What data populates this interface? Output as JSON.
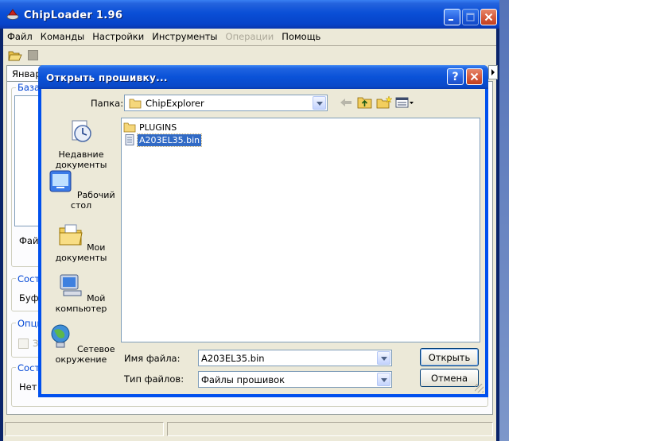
{
  "main_window": {
    "title": "ChipLoader 1.96",
    "menu": [
      {
        "label": "Файл",
        "enabled": true
      },
      {
        "label": "Команды",
        "enabled": true
      },
      {
        "label": "Настройки",
        "enabled": true
      },
      {
        "label": "Инструменты",
        "enabled": true
      },
      {
        "label": "Операции",
        "enabled": false
      },
      {
        "label": "Помощь",
        "enabled": true
      }
    ],
    "tab_label": "Январь",
    "partial_labels": {
      "group1": "База",
      "file": "Файл",
      "group2": "Состо",
      "buffer": "Буфе",
      "group3": "Опци",
      "checkbox": "З",
      "group4": "Состо",
      "status": "Нет с"
    }
  },
  "dialog": {
    "title": "Открыть прошивку...",
    "help_glyph": "?",
    "close_glyph": "✕",
    "look_in_label": "Папка:",
    "look_in_value": "ChipExplorer",
    "places": [
      {
        "label": "Недавние документы",
        "icon": "recent-documents-icon"
      },
      {
        "label": "Рабочий стол",
        "icon": "desktop-icon"
      },
      {
        "label": "Мои документы",
        "icon": "my-documents-icon"
      },
      {
        "label": "Мой компьютер",
        "icon": "my-computer-icon"
      },
      {
        "label": "Сетевое окружение",
        "icon": "network-icon"
      }
    ],
    "files": [
      {
        "name": "PLUGINS",
        "type": "folder",
        "selected": false
      },
      {
        "name": "A203EL35.bin",
        "type": "file",
        "selected": true
      }
    ],
    "file_name_label": "Имя файла:",
    "file_name_value": "A203EL35.bin",
    "file_type_label": "Тип файлов:",
    "file_type_value": "Файлы прошивок",
    "open_button": "Открыть",
    "cancel_button": "Отмена"
  },
  "colors": {
    "title_blue": "#0a52d8",
    "selection": "#316ac5",
    "face": "#ece9d8"
  }
}
